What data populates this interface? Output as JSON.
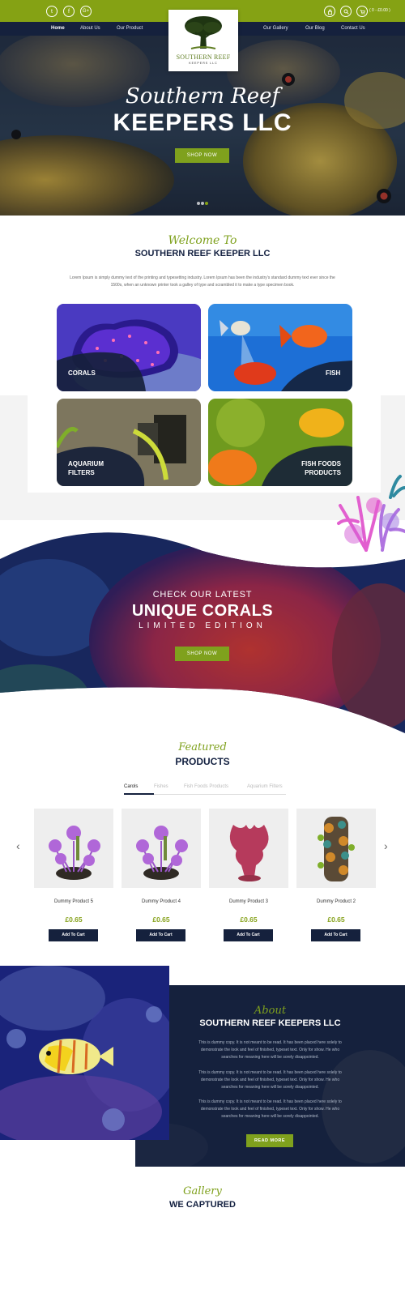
{
  "header": {
    "social_icons": [
      "twitter-icon",
      "facebook-icon",
      "google-plus-icon"
    ],
    "cart_text": "( 0 - £0.00 )",
    "nav_left": [
      "Home",
      "About Us",
      "Our Product"
    ],
    "nav_right": [
      "Our Gallery",
      "Our Blog",
      "Contact Us"
    ],
    "logo_title": "SOUTHERN REEF",
    "logo_sub": "KEEPERS LLC"
  },
  "hero": {
    "script": "Southern Reef",
    "title": "KEEPERS LLC",
    "button": "SHOP NOW",
    "slides": 3,
    "active_slide": 3
  },
  "welcome": {
    "script": "Welcome To",
    "title": "SOUTHERN REEF KEEPER LLC",
    "text_line1": "Lorem Ipsum is simply dummy text of the printing and typesetting industry. Lorem Ipsum has been the industry's standard dummy text ever since the",
    "text_line2": "1500s, when an unknown printer took a galley of type and scrambled it to make a type specimen book."
  },
  "categories": {
    "corals": "CORALS",
    "fish": "FISH",
    "filters_1": "AQUARIUM",
    "filters_2": "FILTERS",
    "foods_1": "FISH FOODS",
    "foods_2": "PRODUCTS"
  },
  "promo": {
    "line1": "CHECK OUR LATEST",
    "line2": "UNIQUE CORALS",
    "line3": "LIMITED EDITION",
    "button": "SHOP NOW"
  },
  "featured": {
    "script": "Featured",
    "title": "PRODUCTS",
    "tabs": [
      "Carols",
      "Fishes",
      "Fish Foods Products",
      "Aquarium Filters"
    ],
    "products": [
      {
        "name": "Dummy Product 5",
        "price": "£0.65",
        "button": "Add To Cart"
      },
      {
        "name": "Dummy Product 4",
        "price": "£0.65",
        "button": "Add To Cart"
      },
      {
        "name": "Dummy Product 3",
        "price": "£0.65",
        "button": "Add To Cart"
      },
      {
        "name": "Dummy Product 2",
        "price": "£0.65",
        "button": "Add To Cart"
      }
    ]
  },
  "about": {
    "script": "About",
    "title": "SOUTHERN REEF KEEPERS LLC",
    "p1_l1": "This is dummy copy. It is not meant to be read. It has been placed here solely to",
    "p1_l2": "demonstrate the look and feel of finished, typeset text. Only for show. He who",
    "p1_l3": "searches for meaning here will be sorely disappointed.",
    "p2_l1": "This is dummy copy. It is not meant to be read. It has been placed here solely to",
    "p2_l2": "demonstrate the look and feel of finished, typeset text. Only for show. He who",
    "p2_l3": "searches for meaning here will be sorely disappointed.",
    "p3_l1": "This is dummy copy. It is not meant to be read. It has been placed here solely to",
    "p3_l2": "demonstrate the look and feel of finished, typeset text. Only for show. He who",
    "p3_l3": "searches for meaning here will be sorely disappointed.",
    "button": "READ MORE"
  },
  "gallery": {
    "script": "Gallery",
    "title": "WE CAPTURED"
  },
  "colors": {
    "green": "#85a214",
    "navy": "#15213d"
  }
}
